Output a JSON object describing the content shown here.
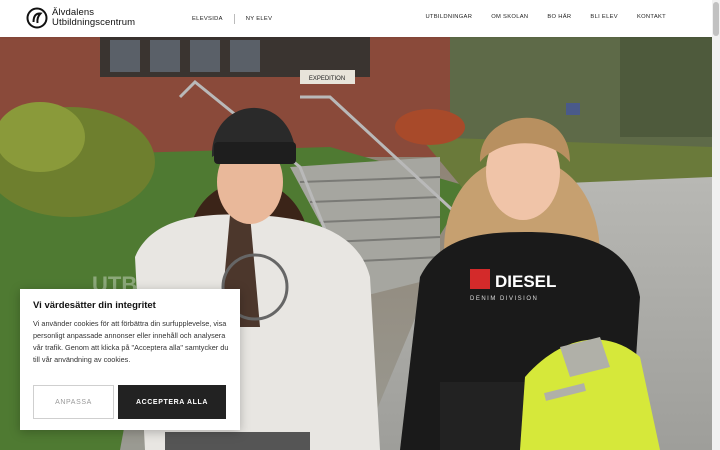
{
  "header": {
    "logo_line1": "Älvdalens",
    "logo_line2": "Utbildningscentrum",
    "nav_left": [
      "ELEVSIDA",
      "NY ELEV"
    ],
    "nav_right": [
      "UTBILDNINGAR",
      "OM SKOLAN",
      "BO HÄR",
      "BLI ELEV",
      "KONTAKT"
    ]
  },
  "hero": {
    "sign_text": "EXPEDITION",
    "watermark_text": "UTBILDNING",
    "shirt_brand": "DIESEL",
    "shirt_sub": "DENIM DIVISION"
  },
  "cookie": {
    "title": "Vi värdesätter din integritet",
    "body": "Vi använder cookies för att förbättra din surfupplevelse, visa personligt anpassade annonser eller innehåll och analysera vår trafik. Genom att klicka på \"Acceptera alla\" samtycker du till vår användning av cookies.",
    "reject_label": "ANPASSA",
    "accept_label": "ACCEPTERA ALLA"
  },
  "colors": {
    "brand_dark": "#222222",
    "header_bg": "#ffffff",
    "vest": "#d6e83a"
  },
  "icons": [
    "logo-circle-icon"
  ]
}
